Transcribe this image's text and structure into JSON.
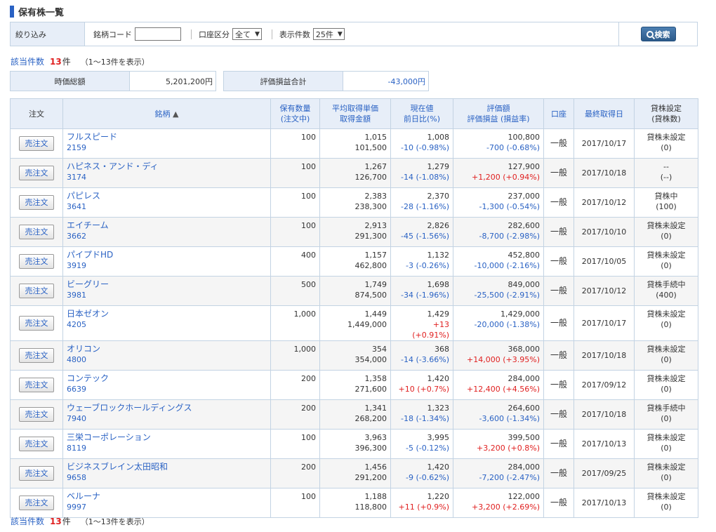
{
  "page": {
    "title": "保有株一覧"
  },
  "filter": {
    "label": "絞り込み",
    "code_label": "銘柄コード",
    "account_label": "口座区分",
    "account_value": "全て",
    "display_label": "表示件数",
    "display_value": "25件",
    "search_label": "検索"
  },
  "count": {
    "label": "該当件数",
    "num": "13",
    "unit": "件",
    "range": "（1〜13件を表示）"
  },
  "summary": {
    "market_label": "時価総額",
    "market_value": "5,201,200円",
    "pl_label": "評価損益合計",
    "pl_value": "-43,000円"
  },
  "table": {
    "headers": {
      "order": "注文",
      "name": "銘柄",
      "sort_mark": "▲",
      "qty_1": "保有数量",
      "qty_2": "(注文中)",
      "avg_1": "平均取得単価",
      "avg_2": "取得金額",
      "price_1": "現在値",
      "price_2": "前日比(%)",
      "val_1": "評価額",
      "val_2": "評価損益 (損益率)",
      "acct": "口座",
      "date": "最終取得日",
      "lend_1": "貸株設定",
      "lend_2": "(貸株数)"
    },
    "order_button_label": "売注文",
    "rows": [
      {
        "name": "フルスピード",
        "code": "2159",
        "qty": "100",
        "avg": "1,015",
        "cost": "101,500",
        "price": "1,008",
        "chg": "-10 (-0.98%)",
        "chg_sign": "neg",
        "val": "100,800",
        "pl": "-700 (-0.68%)",
        "pl_sign": "neg",
        "acct": "一般",
        "date": "2017/10/17",
        "lend1": "貸株未設定",
        "lend2": "(0)"
      },
      {
        "name": "ハピネス・アンド・ディ",
        "code": "3174",
        "qty": "100",
        "avg": "1,267",
        "cost": "126,700",
        "price": "1,279",
        "chg": "-14 (-1.08%)",
        "chg_sign": "neg",
        "val": "127,900",
        "pl": "+1,200 (+0.94%)",
        "pl_sign": "pos",
        "acct": "一般",
        "date": "2017/10/18",
        "lend1": "--",
        "lend2": "(--)"
      },
      {
        "name": "パピレス",
        "code": "3641",
        "qty": "100",
        "avg": "2,383",
        "cost": "238,300",
        "price": "2,370",
        "chg": "-28 (-1.16%)",
        "chg_sign": "neg",
        "val": "237,000",
        "pl": "-1,300 (-0.54%)",
        "pl_sign": "neg",
        "acct": "一般",
        "date": "2017/10/12",
        "lend1": "貸株中",
        "lend2": "(100)"
      },
      {
        "name": "エイチーム",
        "code": "3662",
        "qty": "100",
        "avg": "2,913",
        "cost": "291,300",
        "price": "2,826",
        "chg": "-45 (-1.56%)",
        "chg_sign": "neg",
        "val": "282,600",
        "pl": "-8,700 (-2.98%)",
        "pl_sign": "neg",
        "acct": "一般",
        "date": "2017/10/10",
        "lend1": "貸株未設定",
        "lend2": "(0)"
      },
      {
        "name": "パイプドHD",
        "code": "3919",
        "qty": "400",
        "avg": "1,157",
        "cost": "462,800",
        "price": "1,132",
        "chg": "-3 (-0.26%)",
        "chg_sign": "neg",
        "val": "452,800",
        "pl": "-10,000 (-2.16%)",
        "pl_sign": "neg",
        "acct": "一般",
        "date": "2017/10/05",
        "lend1": "貸株未設定",
        "lend2": "(0)"
      },
      {
        "name": "ビーグリー",
        "code": "3981",
        "qty": "500",
        "avg": "1,749",
        "cost": "874,500",
        "price": "1,698",
        "chg": "-34 (-1.96%)",
        "chg_sign": "neg",
        "val": "849,000",
        "pl": "-25,500 (-2.91%)",
        "pl_sign": "neg",
        "acct": "一般",
        "date": "2017/10/12",
        "lend1": "貸株手続中",
        "lend2": "(400)"
      },
      {
        "name": "日本ゼオン",
        "code": "4205",
        "qty": "1,000",
        "avg": "1,449",
        "cost": "1,449,000",
        "price": "1,429",
        "chg": "+13 (+0.91%)",
        "chg_sign": "pos",
        "val": "1,429,000",
        "pl": "-20,000 (-1.38%)",
        "pl_sign": "neg",
        "acct": "一般",
        "date": "2017/10/17",
        "lend1": "貸株未設定",
        "lend2": "(0)"
      },
      {
        "name": "オリコン",
        "code": "4800",
        "qty": "1,000",
        "avg": "354",
        "cost": "354,000",
        "price": "368",
        "chg": "-14 (-3.66%)",
        "chg_sign": "neg",
        "val": "368,000",
        "pl": "+14,000 (+3.95%)",
        "pl_sign": "pos",
        "acct": "一般",
        "date": "2017/10/18",
        "lend1": "貸株未設定",
        "lend2": "(0)"
      },
      {
        "name": "コンテック",
        "code": "6639",
        "qty": "200",
        "avg": "1,358",
        "cost": "271,600",
        "price": "1,420",
        "chg": "+10 (+0.7%)",
        "chg_sign": "pos",
        "val": "284,000",
        "pl": "+12,400 (+4.56%)",
        "pl_sign": "pos",
        "acct": "一般",
        "date": "2017/09/12",
        "lend1": "貸株未設定",
        "lend2": "(0)"
      },
      {
        "name": "ウェーブロックホールディングス",
        "code": "7940",
        "qty": "200",
        "avg": "1,341",
        "cost": "268,200",
        "price": "1,323",
        "chg": "-18 (-1.34%)",
        "chg_sign": "neg",
        "val": "264,600",
        "pl": "-3,600 (-1.34%)",
        "pl_sign": "neg",
        "acct": "一般",
        "date": "2017/10/18",
        "lend1": "貸株手続中",
        "lend2": "(0)"
      },
      {
        "name": "三栄コーポレーション",
        "code": "8119",
        "qty": "100",
        "avg": "3,963",
        "cost": "396,300",
        "price": "3,995",
        "chg": "-5 (-0.12%)",
        "chg_sign": "neg",
        "val": "399,500",
        "pl": "+3,200 (+0.8%)",
        "pl_sign": "pos",
        "acct": "一般",
        "date": "2017/10/13",
        "lend1": "貸株未設定",
        "lend2": "(0)"
      },
      {
        "name": "ビジネスブレイン太田昭和",
        "code": "9658",
        "qty": "200",
        "avg": "1,456",
        "cost": "291,200",
        "price": "1,420",
        "chg": "-9 (-0.62%)",
        "chg_sign": "neg",
        "val": "284,000",
        "pl": "-7,200 (-2.47%)",
        "pl_sign": "neg",
        "acct": "一般",
        "date": "2017/09/25",
        "lend1": "貸株未設定",
        "lend2": "(0)"
      },
      {
        "name": "ベルーナ",
        "code": "9997",
        "qty": "100",
        "avg": "1,188",
        "cost": "118,800",
        "price": "1,220",
        "chg": "+11 (+0.9%)",
        "chg_sign": "pos",
        "val": "122,000",
        "pl": "+3,200 (+2.69%)",
        "pl_sign": "pos",
        "acct": "一般",
        "date": "2017/10/13",
        "lend1": "貸株未設定",
        "lend2": "(0)"
      }
    ]
  },
  "colors": {
    "accent": "#2a62c4",
    "negative": "#2a62c4",
    "positive": "#e02020",
    "header_bg": "#e7eef8",
    "border": "#c3d3e3"
  }
}
